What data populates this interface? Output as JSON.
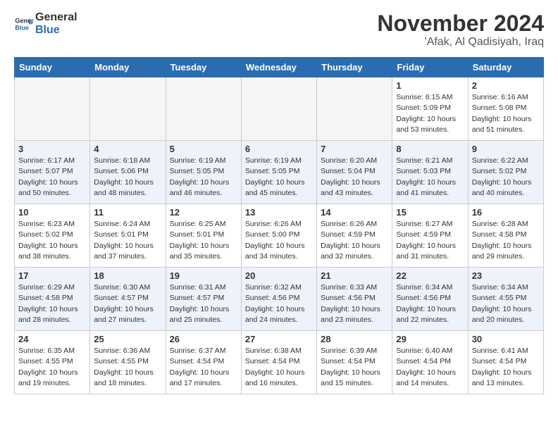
{
  "header": {
    "logo_line1": "General",
    "logo_line2": "Blue",
    "month": "November 2024",
    "location": "'Afak, Al Qadisiyah, Iraq"
  },
  "days_of_week": [
    "Sunday",
    "Monday",
    "Tuesday",
    "Wednesday",
    "Thursday",
    "Friday",
    "Saturday"
  ],
  "weeks": [
    [
      {
        "day": "",
        "empty": true
      },
      {
        "day": "",
        "empty": true
      },
      {
        "day": "",
        "empty": true
      },
      {
        "day": "",
        "empty": true
      },
      {
        "day": "",
        "empty": true
      },
      {
        "day": "1",
        "sunrise": "Sunrise: 6:15 AM",
        "sunset": "Sunset: 5:09 PM",
        "daylight": "Daylight: 10 hours and 53 minutes."
      },
      {
        "day": "2",
        "sunrise": "Sunrise: 6:16 AM",
        "sunset": "Sunset: 5:08 PM",
        "daylight": "Daylight: 10 hours and 51 minutes."
      }
    ],
    [
      {
        "day": "3",
        "sunrise": "Sunrise: 6:17 AM",
        "sunset": "Sunset: 5:07 PM",
        "daylight": "Daylight: 10 hours and 50 minutes."
      },
      {
        "day": "4",
        "sunrise": "Sunrise: 6:18 AM",
        "sunset": "Sunset: 5:06 PM",
        "daylight": "Daylight: 10 hours and 48 minutes."
      },
      {
        "day": "5",
        "sunrise": "Sunrise: 6:19 AM",
        "sunset": "Sunset: 5:05 PM",
        "daylight": "Daylight: 10 hours and 46 minutes."
      },
      {
        "day": "6",
        "sunrise": "Sunrise: 6:19 AM",
        "sunset": "Sunset: 5:05 PM",
        "daylight": "Daylight: 10 hours and 45 minutes."
      },
      {
        "day": "7",
        "sunrise": "Sunrise: 6:20 AM",
        "sunset": "Sunset: 5:04 PM",
        "daylight": "Daylight: 10 hours and 43 minutes."
      },
      {
        "day": "8",
        "sunrise": "Sunrise: 6:21 AM",
        "sunset": "Sunset: 5:03 PM",
        "daylight": "Daylight: 10 hours and 41 minutes."
      },
      {
        "day": "9",
        "sunrise": "Sunrise: 6:22 AM",
        "sunset": "Sunset: 5:02 PM",
        "daylight": "Daylight: 10 hours and 40 minutes."
      }
    ],
    [
      {
        "day": "10",
        "sunrise": "Sunrise: 6:23 AM",
        "sunset": "Sunset: 5:02 PM",
        "daylight": "Daylight: 10 hours and 38 minutes."
      },
      {
        "day": "11",
        "sunrise": "Sunrise: 6:24 AM",
        "sunset": "Sunset: 5:01 PM",
        "daylight": "Daylight: 10 hours and 37 minutes."
      },
      {
        "day": "12",
        "sunrise": "Sunrise: 6:25 AM",
        "sunset": "Sunset: 5:01 PM",
        "daylight": "Daylight: 10 hours and 35 minutes."
      },
      {
        "day": "13",
        "sunrise": "Sunrise: 6:26 AM",
        "sunset": "Sunset: 5:00 PM",
        "daylight": "Daylight: 10 hours and 34 minutes."
      },
      {
        "day": "14",
        "sunrise": "Sunrise: 6:26 AM",
        "sunset": "Sunset: 4:59 PM",
        "daylight": "Daylight: 10 hours and 32 minutes."
      },
      {
        "day": "15",
        "sunrise": "Sunrise: 6:27 AM",
        "sunset": "Sunset: 4:59 PM",
        "daylight": "Daylight: 10 hours and 31 minutes."
      },
      {
        "day": "16",
        "sunrise": "Sunrise: 6:28 AM",
        "sunset": "Sunset: 4:58 PM",
        "daylight": "Daylight: 10 hours and 29 minutes."
      }
    ],
    [
      {
        "day": "17",
        "sunrise": "Sunrise: 6:29 AM",
        "sunset": "Sunset: 4:58 PM",
        "daylight": "Daylight: 10 hours and 28 minutes."
      },
      {
        "day": "18",
        "sunrise": "Sunrise: 6:30 AM",
        "sunset": "Sunset: 4:57 PM",
        "daylight": "Daylight: 10 hours and 27 minutes."
      },
      {
        "day": "19",
        "sunrise": "Sunrise: 6:31 AM",
        "sunset": "Sunset: 4:57 PM",
        "daylight": "Daylight: 10 hours and 25 minutes."
      },
      {
        "day": "20",
        "sunrise": "Sunrise: 6:32 AM",
        "sunset": "Sunset: 4:56 PM",
        "daylight": "Daylight: 10 hours and 24 minutes."
      },
      {
        "day": "21",
        "sunrise": "Sunrise: 6:33 AM",
        "sunset": "Sunset: 4:56 PM",
        "daylight": "Daylight: 10 hours and 23 minutes."
      },
      {
        "day": "22",
        "sunrise": "Sunrise: 6:34 AM",
        "sunset": "Sunset: 4:56 PM",
        "daylight": "Daylight: 10 hours and 22 minutes."
      },
      {
        "day": "23",
        "sunrise": "Sunrise: 6:34 AM",
        "sunset": "Sunset: 4:55 PM",
        "daylight": "Daylight: 10 hours and 20 minutes."
      }
    ],
    [
      {
        "day": "24",
        "sunrise": "Sunrise: 6:35 AM",
        "sunset": "Sunset: 4:55 PM",
        "daylight": "Daylight: 10 hours and 19 minutes."
      },
      {
        "day": "25",
        "sunrise": "Sunrise: 6:36 AM",
        "sunset": "Sunset: 4:55 PM",
        "daylight": "Daylight: 10 hours and 18 minutes."
      },
      {
        "day": "26",
        "sunrise": "Sunrise: 6:37 AM",
        "sunset": "Sunset: 4:54 PM",
        "daylight": "Daylight: 10 hours and 17 minutes."
      },
      {
        "day": "27",
        "sunrise": "Sunrise: 6:38 AM",
        "sunset": "Sunset: 4:54 PM",
        "daylight": "Daylight: 10 hours and 16 minutes."
      },
      {
        "day": "28",
        "sunrise": "Sunrise: 6:39 AM",
        "sunset": "Sunset: 4:54 PM",
        "daylight": "Daylight: 10 hours and 15 minutes."
      },
      {
        "day": "29",
        "sunrise": "Sunrise: 6:40 AM",
        "sunset": "Sunset: 4:54 PM",
        "daylight": "Daylight: 10 hours and 14 minutes."
      },
      {
        "day": "30",
        "sunrise": "Sunrise: 6:41 AM",
        "sunset": "Sunset: 4:54 PM",
        "daylight": "Daylight: 10 hours and 13 minutes."
      }
    ]
  ]
}
